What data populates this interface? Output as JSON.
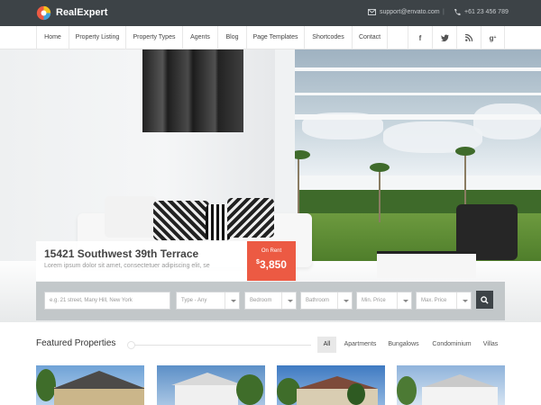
{
  "brand": {
    "name": "RealExpert"
  },
  "contact": {
    "email": "support@envato.com",
    "separator": "|",
    "phone": "+61 23 456 789"
  },
  "nav": {
    "items": [
      "Home",
      "Property Listing",
      "Property Types",
      "Agents",
      "Blog",
      "Page Templates",
      "Shortcodes",
      "Contact"
    ],
    "social": [
      "f",
      "t",
      "rss",
      "g+"
    ]
  },
  "hero": {
    "title": "15421 Southwest 39th Terrace",
    "description": "Lorem ipsum dolor sit amet, consectetuer adipiscing elit, se",
    "status": "On Rent",
    "price_currency": "$",
    "price_value": "3,850"
  },
  "search": {
    "placeholder": "e.g. 21 street, Many Hill, New York",
    "type": "Type - Any",
    "bedroom": "Bedroom",
    "bathroom": "Bathroom",
    "min_price": "Min. Price",
    "max_price": "Max. Price"
  },
  "featured": {
    "title": "Featured Properties",
    "filters": [
      "All",
      "Apartments",
      "Bungalows",
      "Condominium",
      "Villas"
    ],
    "active_filter": "All"
  },
  "colors": {
    "topbar": "#3d4347",
    "accent": "#ec5a43"
  }
}
